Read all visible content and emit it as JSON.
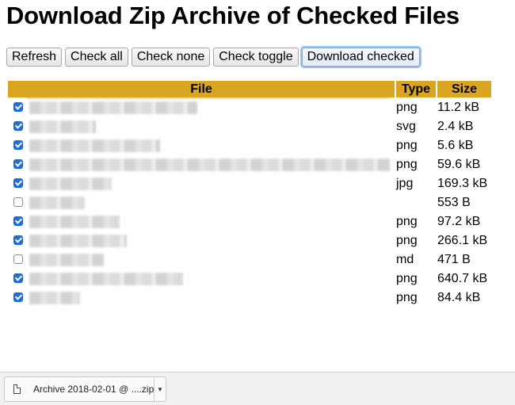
{
  "page_title": "Download Zip Archive of Checked Files",
  "toolbar": {
    "refresh": "Refresh",
    "check_all": "Check all",
    "check_none": "Check none",
    "check_toggle": "Check toggle",
    "download_checked": "Download checked"
  },
  "table": {
    "headers": {
      "file": "File",
      "type": "Type",
      "size": "Size"
    },
    "rows": [
      {
        "checked": true,
        "type": "png",
        "size": "11.2 kB"
      },
      {
        "checked": true,
        "type": "svg",
        "size": "2.4 kB"
      },
      {
        "checked": true,
        "type": "png",
        "size": "5.6 kB"
      },
      {
        "checked": true,
        "type": "png",
        "size": "59.6 kB"
      },
      {
        "checked": true,
        "type": "jpg",
        "size": "169.3 kB"
      },
      {
        "checked": false,
        "type": "",
        "size": "553 B"
      },
      {
        "checked": true,
        "type": "png",
        "size": "97.2 kB"
      },
      {
        "checked": true,
        "type": "png",
        "size": "266.1 kB"
      },
      {
        "checked": false,
        "type": "md",
        "size": "471 B"
      },
      {
        "checked": true,
        "type": "png",
        "size": "640.7 kB"
      },
      {
        "checked": true,
        "type": "png",
        "size": "84.4 kB"
      }
    ]
  },
  "download_bar": {
    "item_name": "Archive 2018-02-01 @ ....zip",
    "arrow_icon": "chevron-down-icon",
    "file_icon": "file-icon"
  },
  "colors": {
    "header_bg": "#daa520",
    "checkbox_checked": "#1d6fe0"
  }
}
